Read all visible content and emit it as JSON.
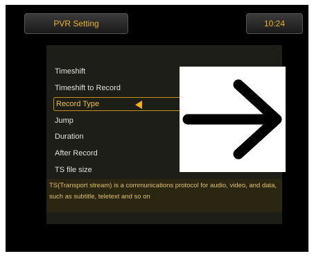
{
  "header": {
    "title": "PVR Setting",
    "time": "10:24"
  },
  "menu": {
    "items": [
      {
        "label": "Timeshift"
      },
      {
        "label": "Timeshift to Record"
      },
      {
        "label": "Record Type"
      },
      {
        "label": "Jump"
      },
      {
        "label": "Duration"
      },
      {
        "label": "After Record"
      },
      {
        "label": "TS file size"
      }
    ],
    "selected_index": 2
  },
  "description": "TS(Transport stream) is a communications protocol for audio, video, and data, such as subtitle, teletext and so on",
  "overlay": {
    "icon": "right-arrow-icon"
  },
  "colors": {
    "accent": "#f0b020",
    "text": "#e0e0e0",
    "background": "#000000"
  }
}
